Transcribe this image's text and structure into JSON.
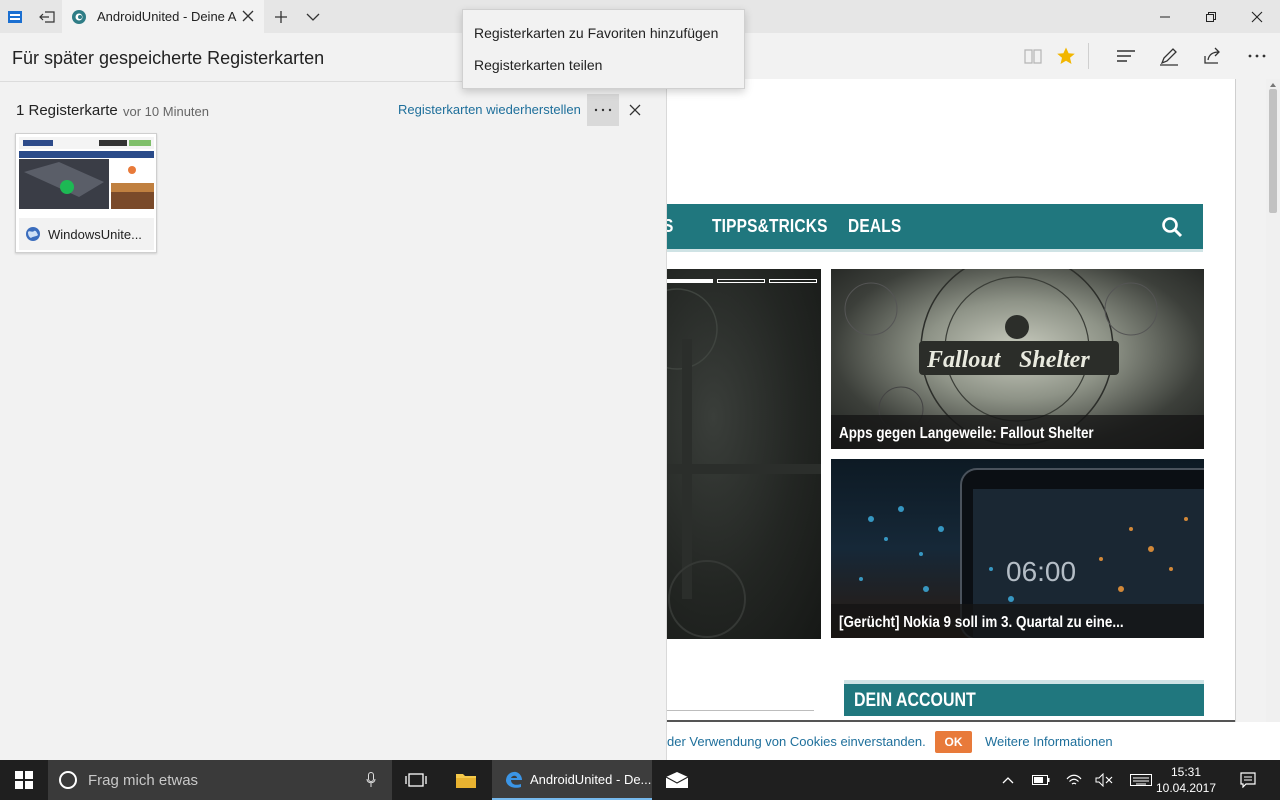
{
  "tab": {
    "title": "AndroidUnited - Deine A"
  },
  "panel": {
    "title": "Für später gespeicherte Registerkarten",
    "group_title": "1 Registerkarte",
    "group_time": "vor 10 Minuten",
    "restore_label": "Registerkarten wiederherstellen",
    "more_label": "···",
    "thumbnail_label": "WindowsUnite..."
  },
  "context_menu": {
    "items": [
      "Registerkarten zu Favoriten hinzufügen",
      "Registerkarten teilen"
    ]
  },
  "page": {
    "nav_items": [
      "S",
      "TIPPS&TRICKS",
      "DEALS"
    ],
    "cards": [
      "Apps gegen Langeweile: Fallout Shelter",
      "[Gerücht] Nokia 9 soll im 3. Quartal zu eine..."
    ],
    "fallout_logo": [
      "Fallout",
      "Shelter"
    ],
    "phone_time": "06:00",
    "account_title": "DEIN ACCOUNT",
    "cookie_text": "der Verwendung von Cookies einverstanden.",
    "cookie_ok": "OK",
    "cookie_more": "Weitere Informationen"
  },
  "taskbar": {
    "search_placeholder": "Frag mich etwas",
    "edge_label": "AndroidUnited - De...",
    "time": "15:31",
    "date": "10.04.2017"
  },
  "colors": {
    "accent_teal": "#20777e",
    "link_blue": "#1e6f9b",
    "ok_orange": "#e87a3a",
    "favorite_star": "#f2b600"
  }
}
